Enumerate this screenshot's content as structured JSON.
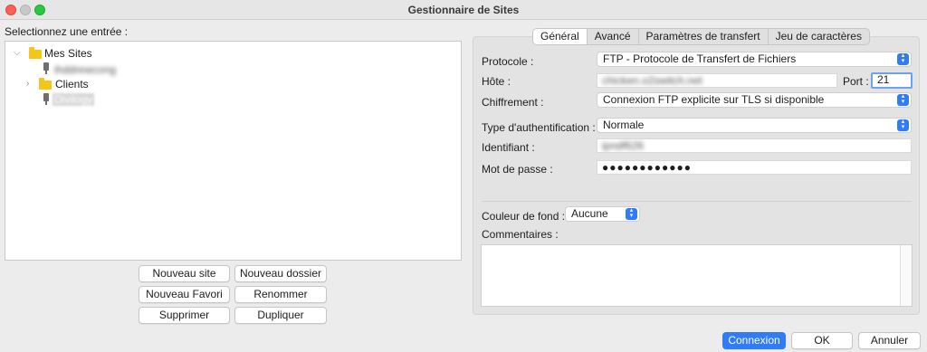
{
  "window": {
    "title": "Gestionnaire de Sites"
  },
  "left": {
    "prompt": "Selectionnez une entrée :",
    "tree": {
      "root": "Mes Sites",
      "site1": "ihddrewcong",
      "folder": "Clients",
      "site2": "Divilogy"
    },
    "buttons": {
      "new_site": "Nouveau site",
      "new_folder": "Nouveau dossier",
      "new_bookmark": "Nouveau Favori",
      "rename": "Renommer",
      "delete": "Supprimer",
      "duplicate": "Dupliquer"
    }
  },
  "tabs": [
    "Général",
    "Avancé",
    "Paramètres de transfert",
    "Jeu de caractères"
  ],
  "form": {
    "protocol_label": "Protocole :",
    "protocol_value": "FTP - Protocole de Transfert de Fichiers",
    "host_label": "Hôte :",
    "host_value": "chicken.o2switch.net",
    "port_label": "Port :",
    "port_value": "21",
    "encryption_label": "Chiffrement :",
    "encryption_value": "Connexion FTP explicite sur TLS si disponible",
    "auth_label": "Type d'authentification :",
    "auth_value": "Normale",
    "user_label": "Identifiant :",
    "user_value": "ipndf626",
    "password_label": "Mot de passe :",
    "password_value": "●●●●●●●●●●●●",
    "bgcolor_label": "Couleur de fond :",
    "bgcolor_value": "Aucune",
    "comments_label": "Commentaires :"
  },
  "footer": {
    "connect": "Connexion",
    "ok": "OK",
    "cancel": "Annuler"
  },
  "colors": {
    "accent": "#2f7cf6",
    "folder": "#f5c518"
  }
}
